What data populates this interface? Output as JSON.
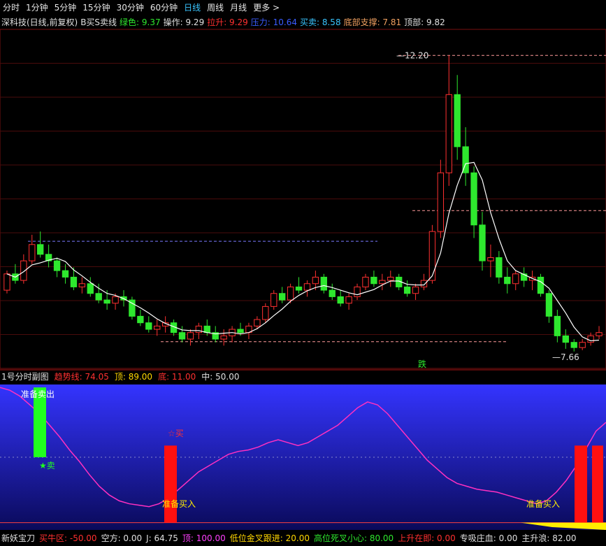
{
  "toolbar": {
    "items": [
      "分时",
      "1分钟",
      "5分钟",
      "15分钟",
      "30分钟",
      "60分钟",
      "日线",
      "周线",
      "月线",
      "更多 >"
    ],
    "active": "日线"
  },
  "main_info": {
    "title": "深科技(日线,前复权)",
    "indicator": "B买S卖线",
    "fields": [
      {
        "text": "绿色: 9.37",
        "color": "#2ee82e"
      },
      {
        "text": "操作: 9.29",
        "color": "#e0e0e0"
      },
      {
        "text": "拉升: 9.29",
        "color": "#ff3030"
      },
      {
        "text": "压力: 10.64",
        "color": "#3a5cff"
      },
      {
        "text": "买卖: 8.58",
        "color": "#39c5ff"
      },
      {
        "text": "底部支撑: 7.81",
        "color": "#f0a060"
      },
      {
        "text": "顶部: 9.82",
        "color": "#e0e0e0"
      }
    ]
  },
  "sub_info": {
    "title": "1号分时副图",
    "fields": [
      {
        "text": "趋势线: 74.05",
        "color": "#ff3030"
      },
      {
        "text": "顶: 89.00",
        "color": "#ffd700"
      },
      {
        "text": "底: 11.00",
        "color": "#ff3030"
      },
      {
        "text": "中: 50.00",
        "color": "#e0e0e0"
      }
    ]
  },
  "bottom_info": {
    "fields": [
      {
        "text": "新妖宝刀",
        "color": "#e0e0e0"
      },
      {
        "text": "买牛区: -50.00",
        "color": "#ff3030"
      },
      {
        "text": "空方: 0.00",
        "color": "#e0e0e0"
      },
      {
        "text": "J: 64.75",
        "color": "#e0e0e0"
      },
      {
        "text": "顶: 100.00",
        "color": "#ff40ff"
      },
      {
        "text": "低位金叉跟进: 20.00",
        "color": "#ffd700"
      },
      {
        "text": "高位死叉小心: 80.00",
        "color": "#2ee82e"
      },
      {
        "text": "上升在即: 0.00",
        "color": "#ff3030"
      },
      {
        "text": "专吸庄血: 0.00",
        "color": "#e0e0e0"
      },
      {
        "text": "主升浪: 82.00",
        "color": "#e0e0e0"
      }
    ]
  },
  "chart_data": [
    {
      "type": "candlestick",
      "title": "深科技(日线,前复权)",
      "annotations": {
        "high": "12.20",
        "low": "7.66",
        "fall": "跌"
      },
      "ohlc": [
        [
          8.6,
          8.9,
          8.55,
          8.85
        ],
        [
          8.85,
          9.0,
          8.7,
          8.75
        ],
        [
          8.75,
          9.15,
          8.7,
          9.05
        ],
        [
          9.05,
          9.45,
          9.0,
          9.3
        ],
        [
          9.3,
          9.5,
          9.1,
          9.15
        ],
        [
          9.15,
          9.3,
          8.95,
          9.05
        ],
        [
          9.05,
          9.1,
          8.8,
          8.9
        ],
        [
          8.9,
          9.0,
          8.7,
          8.8
        ],
        [
          8.8,
          8.95,
          8.6,
          8.65
        ],
        [
          8.65,
          8.8,
          8.55,
          8.7
        ],
        [
          8.7,
          8.8,
          8.5,
          8.55
        ],
        [
          8.55,
          8.7,
          8.4,
          8.45
        ],
        [
          8.45,
          8.6,
          8.3,
          8.4
        ],
        [
          8.4,
          8.55,
          8.3,
          8.5
        ],
        [
          8.5,
          8.6,
          8.35,
          8.45
        ],
        [
          8.45,
          8.5,
          8.15,
          8.2
        ],
        [
          8.2,
          8.3,
          8.05,
          8.1
        ],
        [
          8.1,
          8.2,
          7.95,
          8.0
        ],
        [
          8.0,
          8.15,
          7.9,
          8.05
        ],
        [
          8.05,
          8.2,
          7.95,
          8.1
        ],
        [
          8.1,
          8.15,
          7.9,
          7.95
        ],
        [
          7.95,
          8.05,
          7.8,
          7.85
        ],
        [
          7.85,
          8.0,
          7.75,
          7.95
        ],
        [
          7.95,
          8.1,
          7.85,
          8.05
        ],
        [
          8.05,
          8.15,
          7.9,
          7.95
        ],
        [
          7.95,
          8.05,
          7.8,
          7.85
        ],
        [
          7.85,
          8.0,
          7.75,
          7.9
        ],
        [
          7.9,
          8.05,
          7.8,
          8.0
        ],
        [
          8.0,
          8.1,
          7.9,
          7.95
        ],
        [
          7.95,
          8.1,
          7.85,
          8.05
        ],
        [
          8.05,
          8.2,
          8.0,
          8.15
        ],
        [
          8.15,
          8.4,
          8.1,
          8.35
        ],
        [
          8.35,
          8.6,
          8.3,
          8.55
        ],
        [
          8.55,
          8.65,
          8.4,
          8.45
        ],
        [
          8.45,
          8.7,
          8.4,
          8.65
        ],
        [
          8.65,
          8.8,
          8.55,
          8.6
        ],
        [
          8.6,
          8.75,
          8.5,
          8.7
        ],
        [
          8.7,
          8.9,
          8.6,
          8.8
        ],
        [
          8.8,
          8.85,
          8.55,
          8.6
        ],
        [
          8.6,
          8.7,
          8.45,
          8.5
        ],
        [
          8.5,
          8.6,
          8.35,
          8.4
        ],
        [
          8.4,
          8.55,
          8.3,
          8.5
        ],
        [
          8.5,
          8.7,
          8.45,
          8.65
        ],
        [
          8.65,
          8.85,
          8.6,
          8.8
        ],
        [
          8.8,
          8.9,
          8.65,
          8.7
        ],
        [
          8.7,
          8.85,
          8.6,
          8.75
        ],
        [
          8.75,
          8.9,
          8.65,
          8.8
        ],
        [
          8.8,
          8.85,
          8.6,
          8.65
        ],
        [
          8.65,
          8.75,
          8.5,
          8.55
        ],
        [
          8.55,
          8.7,
          8.45,
          8.65
        ],
        [
          8.65,
          8.85,
          8.6,
          8.75
        ],
        [
          8.75,
          9.6,
          8.7,
          9.5
        ],
        [
          9.5,
          10.6,
          9.4,
          10.4
        ],
        [
          10.4,
          12.2,
          10.2,
          11.6
        ],
        [
          11.6,
          11.9,
          10.6,
          10.8
        ],
        [
          10.8,
          11.1,
          10.2,
          10.4
        ],
        [
          10.4,
          10.5,
          9.4,
          9.6
        ],
        [
          9.6,
          9.8,
          8.9,
          9.05
        ],
        [
          9.05,
          9.3,
          8.8,
          9.1
        ],
        [
          9.1,
          9.2,
          8.7,
          8.8
        ],
        [
          8.8,
          8.95,
          8.55,
          8.7
        ],
        [
          8.7,
          8.9,
          8.6,
          8.85
        ],
        [
          8.85,
          8.95,
          8.65,
          8.75
        ],
        [
          8.75,
          8.9,
          8.6,
          8.8
        ],
        [
          8.8,
          8.85,
          8.5,
          8.55
        ],
        [
          8.55,
          8.6,
          8.1,
          8.2
        ],
        [
          8.2,
          8.3,
          7.8,
          7.9
        ],
        [
          7.9,
          8.0,
          7.7,
          7.8
        ],
        [
          7.8,
          7.85,
          7.66,
          7.72
        ],
        [
          7.72,
          7.85,
          7.68,
          7.8
        ],
        [
          7.8,
          7.95,
          7.75,
          7.9
        ],
        [
          7.9,
          8.05,
          7.85,
          7.95
        ]
      ],
      "support": 7.81,
      "top": 9.82
    },
    {
      "type": "line",
      "title": "1号分时副图",
      "series": [
        {
          "name": "趋势线",
          "values": [
            98,
            96,
            92,
            86,
            80,
            72,
            64,
            55,
            47,
            38,
            30,
            24,
            20,
            18,
            17,
            16,
            18,
            22,
            28,
            34,
            40,
            44,
            48,
            52,
            54,
            55,
            57,
            60,
            62,
            60,
            58,
            60,
            64,
            68,
            72,
            78,
            84,
            88,
            86,
            80,
            72,
            64,
            56,
            48,
            42,
            36,
            32,
            30,
            28,
            27,
            26,
            24,
            22,
            20,
            18,
            20,
            26,
            34,
            44,
            56,
            68,
            74
          ]
        }
      ],
      "ylim": [
        0,
        100
      ],
      "levels": {
        "顶": 89,
        "中": 50,
        "底": 11
      },
      "labels": {
        "sell_ready": "准备卖出",
        "sell": "★卖",
        "buy_ready": "准备买入",
        "buy": "☆买"
      }
    }
  ]
}
